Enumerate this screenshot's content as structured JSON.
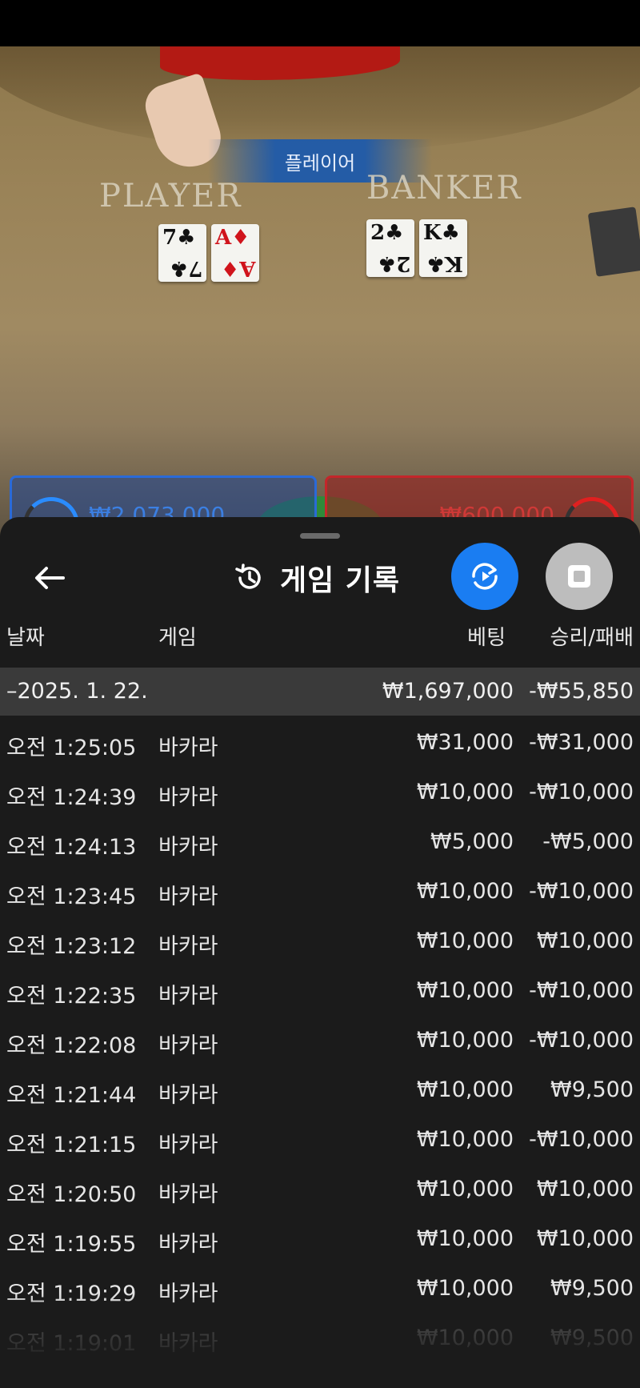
{
  "video": {
    "banner": "플레이어",
    "player_label": "PLAYER",
    "banker_label": "BANKER",
    "player_cards": [
      {
        "rank": "7",
        "suit": "♣",
        "color": "black"
      },
      {
        "rank": "A",
        "suit": "♦",
        "color": "red"
      }
    ],
    "banker_cards": [
      {
        "rank": "2",
        "suit": "♣",
        "color": "black"
      },
      {
        "rank": "K",
        "suit": "♣",
        "color": "black"
      }
    ],
    "player_bet_total": "₩2,073,000",
    "banker_bet_total": "₩600,000"
  },
  "history": {
    "title": "게임 기록",
    "title_icon": "history-icon",
    "back_icon": "arrow-left-icon",
    "replay_icon": "replay-icon",
    "stop_icon": "stop-icon",
    "replay_color": "#1a7df2",
    "columns": {
      "date": "날짜",
      "game": "게임",
      "bet": "베팅",
      "result": "승리/패배"
    },
    "date_group": {
      "label": "–2025. 1. 22.",
      "bet": "₩1,697,000",
      "result": "-₩55,850"
    },
    "rows": [
      {
        "time": "오전 1:25:05",
        "game": "바카라",
        "bet": "₩31,000",
        "result": "-₩31,000"
      },
      {
        "time": "오전 1:24:39",
        "game": "바카라",
        "bet": "₩10,000",
        "result": "-₩10,000"
      },
      {
        "time": "오전 1:24:13",
        "game": "바카라",
        "bet": "₩5,000",
        "result": "-₩5,000"
      },
      {
        "time": "오전 1:23:45",
        "game": "바카라",
        "bet": "₩10,000",
        "result": "-₩10,000"
      },
      {
        "time": "오전 1:23:12",
        "game": "바카라",
        "bet": "₩10,000",
        "result": "₩10,000"
      },
      {
        "time": "오전 1:22:35",
        "game": "바카라",
        "bet": "₩10,000",
        "result": "-₩10,000"
      },
      {
        "time": "오전 1:22:08",
        "game": "바카라",
        "bet": "₩10,000",
        "result": "-₩10,000"
      },
      {
        "time": "오전 1:21:44",
        "game": "바카라",
        "bet": "₩10,000",
        "result": "₩9,500"
      },
      {
        "time": "오전 1:21:15",
        "game": "바카라",
        "bet": "₩10,000",
        "result": "-₩10,000"
      },
      {
        "time": "오전 1:20:50",
        "game": "바카라",
        "bet": "₩10,000",
        "result": "₩10,000"
      },
      {
        "time": "오전 1:19:55",
        "game": "바카라",
        "bet": "₩10,000",
        "result": "₩10,000"
      },
      {
        "time": "오전 1:19:29",
        "game": "바카라",
        "bet": "₩10,000",
        "result": "₩9,500"
      },
      {
        "time": "오전 1:19:01",
        "game": "바카라",
        "bet": "₩10,000",
        "result": "₩9,500"
      }
    ]
  }
}
